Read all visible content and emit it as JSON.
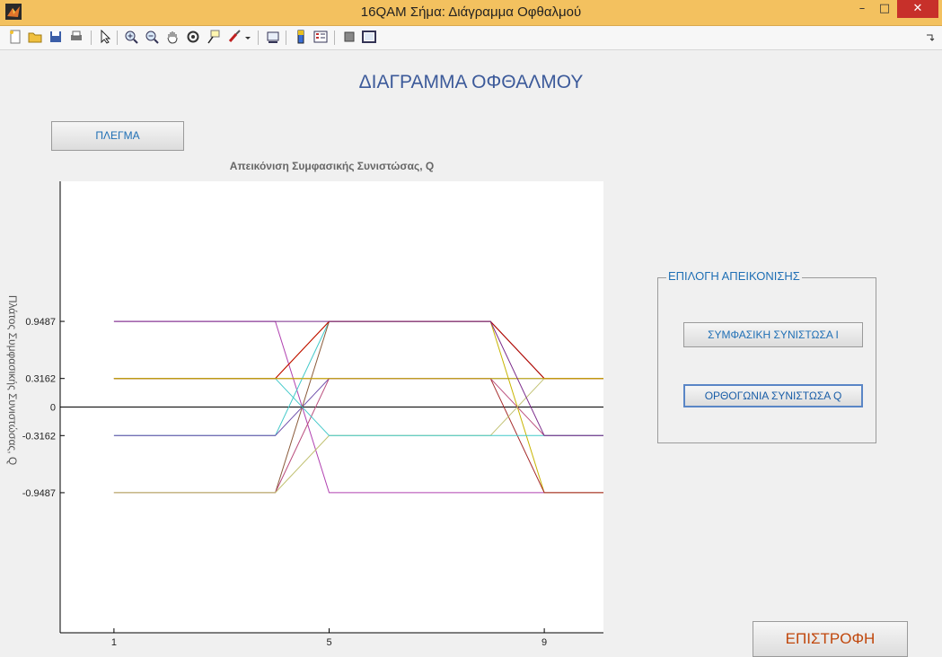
{
  "window": {
    "title": "16QAM Σήμα: Διάγραμμα Οφθαλμού",
    "controls": {
      "minimize": "–",
      "maximize": "□",
      "close": "✕"
    }
  },
  "toolbar": {
    "icons": [
      "new-file-icon",
      "open-folder-icon",
      "save-icon",
      "print-icon",
      "pointer-icon",
      "zoom-in-icon",
      "zoom-out-icon",
      "pan-hand-icon",
      "rotate-3d-icon",
      "data-cursor-icon",
      "brush-icon",
      "brush-dropdown-icon",
      "link-plot-icon",
      "colorbar-icon",
      "legend-icon",
      "hide-plot-tools-icon",
      "show-plot-tools-icon"
    ]
  },
  "main": {
    "page_title": "ΔΙΑΓΡΑΜΜΑ ΟΦΘΑΛΜΟΥ",
    "grid_button": "ΠΛΕΓΜΑ",
    "return_button": "ΕΠΙΣΤΡΟΦΗ"
  },
  "selection": {
    "group_label": "ΕΠΙΛΟΓΗ ΑΠΕΙΚΟΝΙΣΗΣ",
    "in_phase_button": "ΣΥΜΦΑΣΙΚΗ ΣΥΝΙΣΤΩΣΑ Ι",
    "quadrature_button": "ΟΡΘΟΓΩΝΙΑ ΣΥΝΙΣΤΩΣΑ Q"
  },
  "chart_data": {
    "type": "line",
    "title": "Απεικόνιση Συμφασικής Συνιστώσας, Q",
    "xlabel": "",
    "ylabel": "Πλάτος Συμφασικής Συνιστώσας, Q",
    "xticks": [
      "1",
      "5",
      "9"
    ],
    "yticks": [
      "0.9487",
      "0.3162",
      "0",
      "-0.3162",
      "-0.9487"
    ],
    "xlim": [
      0,
      10.1
    ],
    "ylim": [
      -2.5,
      2.5
    ],
    "zero_line": true,
    "series": [
      {
        "color": "#b040b0",
        "x": [
          1,
          4,
          5,
          8,
          9,
          10.1
        ],
        "y": [
          0.9487,
          0.9487,
          -0.9487,
          -0.9487,
          -0.9487,
          -0.9487
        ]
      },
      {
        "color": "#c8b400",
        "x": [
          1,
          4,
          5,
          8,
          9,
          10.1
        ],
        "y": [
          0.3162,
          0.3162,
          0.9487,
          0.9487,
          -0.9487,
          -0.9487
        ]
      },
      {
        "color": "#a52a2a",
        "x": [
          1,
          4,
          5,
          8,
          9,
          10.1
        ],
        "y": [
          0.3162,
          0.3162,
          0.3162,
          0.3162,
          -0.9487,
          -0.9487
        ]
      },
      {
        "color": "#40c8c8",
        "x": [
          1,
          4,
          5,
          8,
          9,
          10.1
        ],
        "y": [
          -0.3162,
          -0.3162,
          0.9487,
          0.9487,
          0.3162,
          0.3162
        ]
      },
      {
        "color": "#6a4aa8",
        "x": [
          1,
          4,
          5,
          8,
          9,
          10.1
        ],
        "y": [
          -0.3162,
          -0.3162,
          0.3162,
          0.3162,
          0.3162,
          0.3162
        ]
      },
      {
        "color": "#8a5a3a",
        "x": [
          1,
          4,
          5,
          8,
          9,
          10.1
        ],
        "y": [
          -0.9487,
          -0.9487,
          0.9487,
          0.9487,
          0.3162,
          0.3162
        ]
      },
      {
        "color": "#b84a7a",
        "x": [
          1,
          4,
          5,
          8,
          9,
          10.1
        ],
        "y": [
          -0.9487,
          -0.9487,
          0.3162,
          0.3162,
          -0.3162,
          -0.3162
        ]
      },
      {
        "color": "#c0c070",
        "x": [
          1,
          4,
          5,
          8,
          9,
          10.1
        ],
        "y": [
          -0.9487,
          -0.9487,
          -0.3162,
          -0.3162,
          0.3162,
          0.3162
        ]
      },
      {
        "color": "#40c8c8",
        "x": [
          1,
          4,
          5,
          8,
          9,
          10.1
        ],
        "y": [
          0.3162,
          0.3162,
          -0.3162,
          -0.3162,
          -0.3162,
          -0.3162
        ]
      },
      {
        "color": "#c00000",
        "x": [
          1,
          4,
          5,
          8,
          9,
          10.1
        ],
        "y": [
          0.3162,
          0.3162,
          0.9487,
          0.9487,
          0.3162,
          0.3162
        ]
      },
      {
        "color": "#c8b400",
        "x": [
          1,
          4,
          5,
          8,
          9,
          10.1
        ],
        "y": [
          0.3162,
          0.3162,
          0.3162,
          0.3162,
          0.3162,
          0.3162
        ]
      },
      {
        "color": "#7a2a8a",
        "x": [
          1,
          4,
          5,
          8,
          9,
          10.1
        ],
        "y": [
          0.9487,
          0.9487,
          0.9487,
          0.9487,
          -0.3162,
          -0.3162
        ]
      }
    ]
  }
}
